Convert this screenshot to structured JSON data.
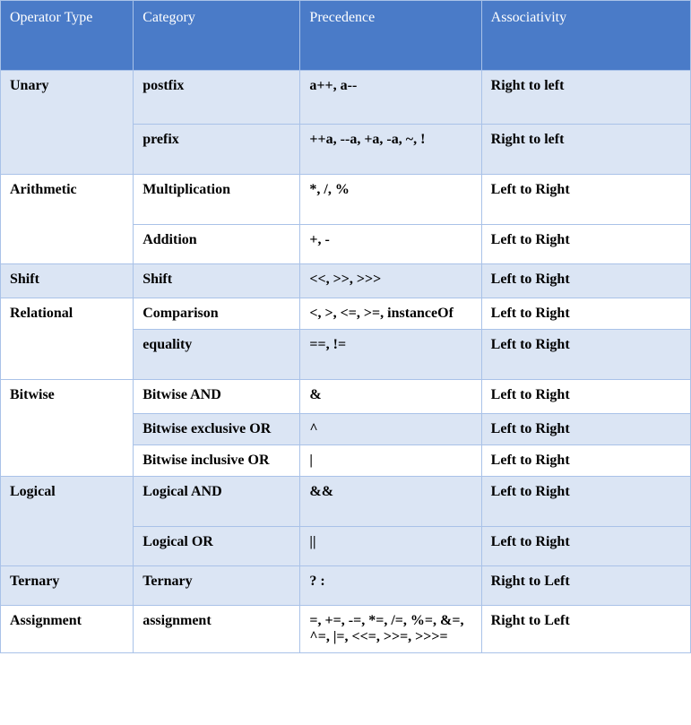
{
  "headers": [
    "Operator Type",
    "Category",
    "Precedence",
    "Associativity"
  ],
  "rows": [
    {
      "type": "Unary",
      "rowspan": 2,
      "shade": true,
      "category": "postfix",
      "precedence": "a++, a--",
      "associativity": "Right to left",
      "h": "h60"
    },
    {
      "type": null,
      "shade": true,
      "category": "prefix",
      "precedence": "++a, --a, +a, -a, ~, !",
      "associativity": "Right to left",
      "h": "h56"
    },
    {
      "type": "Arithmetic",
      "rowspan": 2,
      "shade": false,
      "category": "Multiplication",
      "precedence": "*, /, %",
      "associativity": "Left to Right",
      "h": "h56"
    },
    {
      "type": null,
      "shade": false,
      "category": "Addition",
      "precedence": "+, -",
      "associativity": "Left to Right",
      "h": "h44"
    },
    {
      "type": "Shift",
      "rowspan": 1,
      "shade": true,
      "category": "Shift",
      "precedence": "<<, >>, >>>",
      "associativity": "Left to Right",
      "h": "h38"
    },
    {
      "type": "Relational",
      "rowspan": 2,
      "shade": false,
      "typeShade": false,
      "category": "Comparison",
      "catShade": false,
      "precedence": "<, >, <=, >=, instanceOf",
      "associativity": "Left to Right",
      "h": ""
    },
    {
      "type": null,
      "shade": true,
      "category": "equality",
      "precedence": "==, !=",
      "associativity": "Left to Right",
      "h": "h56"
    },
    {
      "type": "Bitwise",
      "rowspan": 3,
      "shade": false,
      "category": "Bitwise AND",
      "precedence": "&",
      "associativity": "Left to Right",
      "h": "h38"
    },
    {
      "type": null,
      "shade": true,
      "category": "Bitwise exclusive OR",
      "precedence": "^",
      "associativity": "Left to Right",
      "h": ""
    },
    {
      "type": null,
      "shade": false,
      "category": "Bitwise inclusive OR",
      "precedence": "|",
      "associativity": "Left to Right",
      "h": ""
    },
    {
      "type": "Logical",
      "rowspan": 2,
      "shade": true,
      "category": "Logical AND",
      "precedence": "&&",
      "associativity": "Left to Right",
      "h": "h56"
    },
    {
      "type": null,
      "shade": true,
      "category": "Logical OR",
      "precedence": "||",
      "associativity": "Left to Right",
      "h": "h44"
    },
    {
      "type": "Ternary",
      "rowspan": 1,
      "shade": true,
      "category": "Ternary",
      "precedence": "? :",
      "associativity": "Right to Left",
      "h": "h44"
    },
    {
      "type": "Assignment",
      "rowspan": 1,
      "shade": false,
      "category": "assignment",
      "precedence": "=, +=, -=, *=, /=, %=, &=, ^=, |=, <<=, >>=, >>>=",
      "associativity": "Right to Left",
      "h": ""
    }
  ]
}
